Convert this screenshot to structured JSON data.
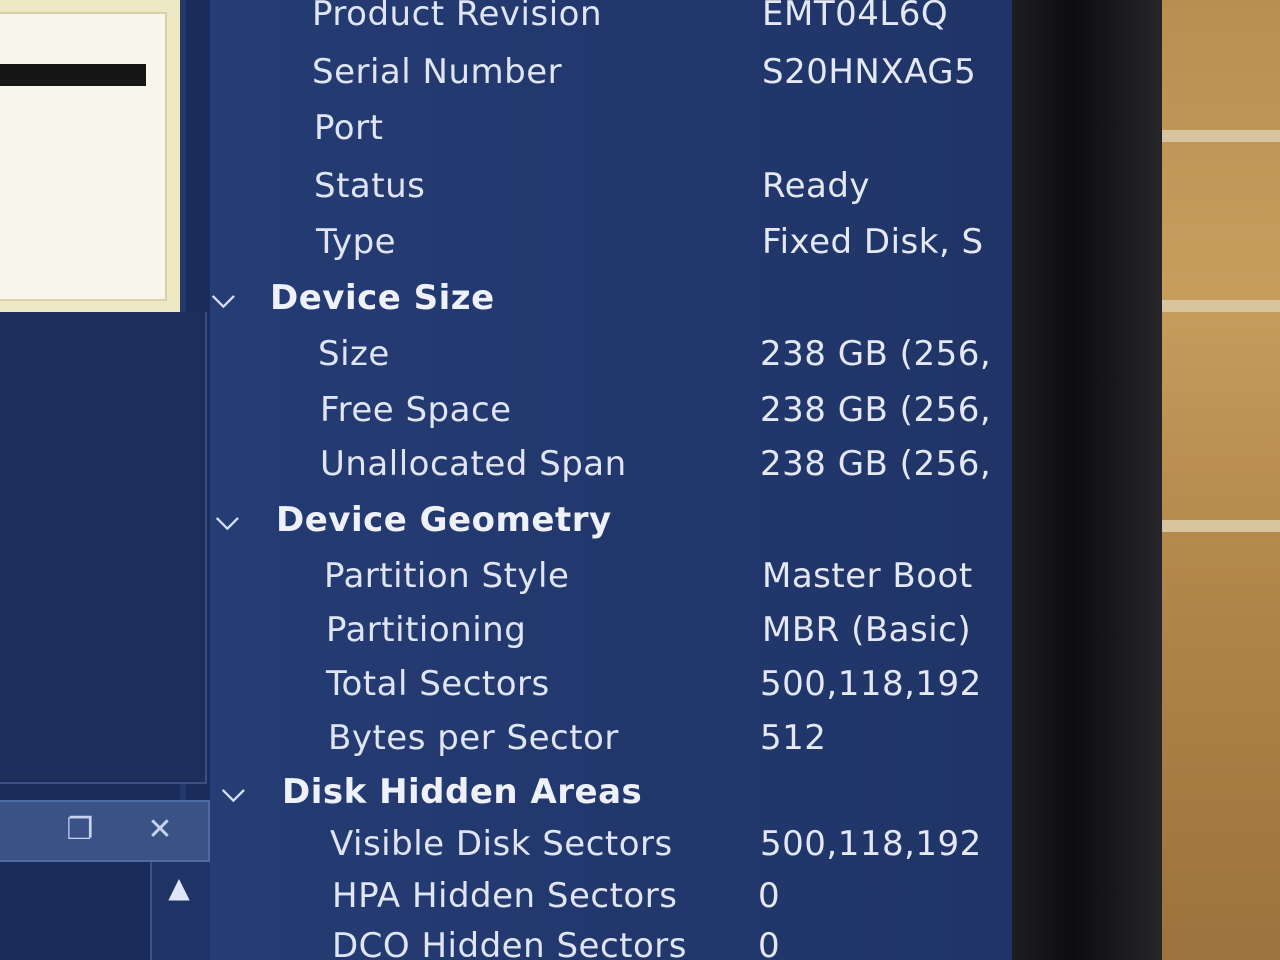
{
  "properties": [
    {
      "kind": "item",
      "label": "Product Revision",
      "value": "EMT04L6Q"
    },
    {
      "kind": "item",
      "label": "Serial Number",
      "value": "S20HNXAG5"
    },
    {
      "kind": "item",
      "label": "Port",
      "value": ""
    },
    {
      "kind": "item",
      "label": "Status",
      "value": "Ready"
    },
    {
      "kind": "item",
      "label": "Type",
      "value": "Fixed Disk, S"
    },
    {
      "kind": "group",
      "label": "Device Size"
    },
    {
      "kind": "item",
      "label": "Size",
      "value": "238 GB (256,"
    },
    {
      "kind": "item",
      "label": "Free Space",
      "value": "238 GB (256,"
    },
    {
      "kind": "item",
      "label": "Unallocated Span",
      "value": "238 GB (256,"
    },
    {
      "kind": "group",
      "label": "Device Geometry"
    },
    {
      "kind": "item",
      "label": "Partition Style",
      "value": "Master Boot"
    },
    {
      "kind": "item",
      "label": "Partitioning",
      "value": "MBR (Basic)"
    },
    {
      "kind": "item",
      "label": "Total Sectors",
      "value": "500,118,192"
    },
    {
      "kind": "item",
      "label": "Bytes per Sector",
      "value": "512"
    },
    {
      "kind": "group",
      "label": "Disk Hidden Areas"
    },
    {
      "kind": "item",
      "label": "Visible Disk Sectors",
      "value": "500,118,192"
    },
    {
      "kind": "item",
      "label": "HPA Hidden Sectors",
      "value": "0"
    },
    {
      "kind": "item",
      "label": "DCO Hidden Sectors",
      "value": "0"
    }
  ],
  "icons": {
    "expand": "chevron-down-icon",
    "restore": "restore-window-icon",
    "close": "close-icon",
    "scroll_up": "scroll-up-arrow-icon"
  },
  "colors": {
    "pane_background": "#22386d",
    "text": "#dfe5f4",
    "side_panel": "#efe8c4"
  }
}
